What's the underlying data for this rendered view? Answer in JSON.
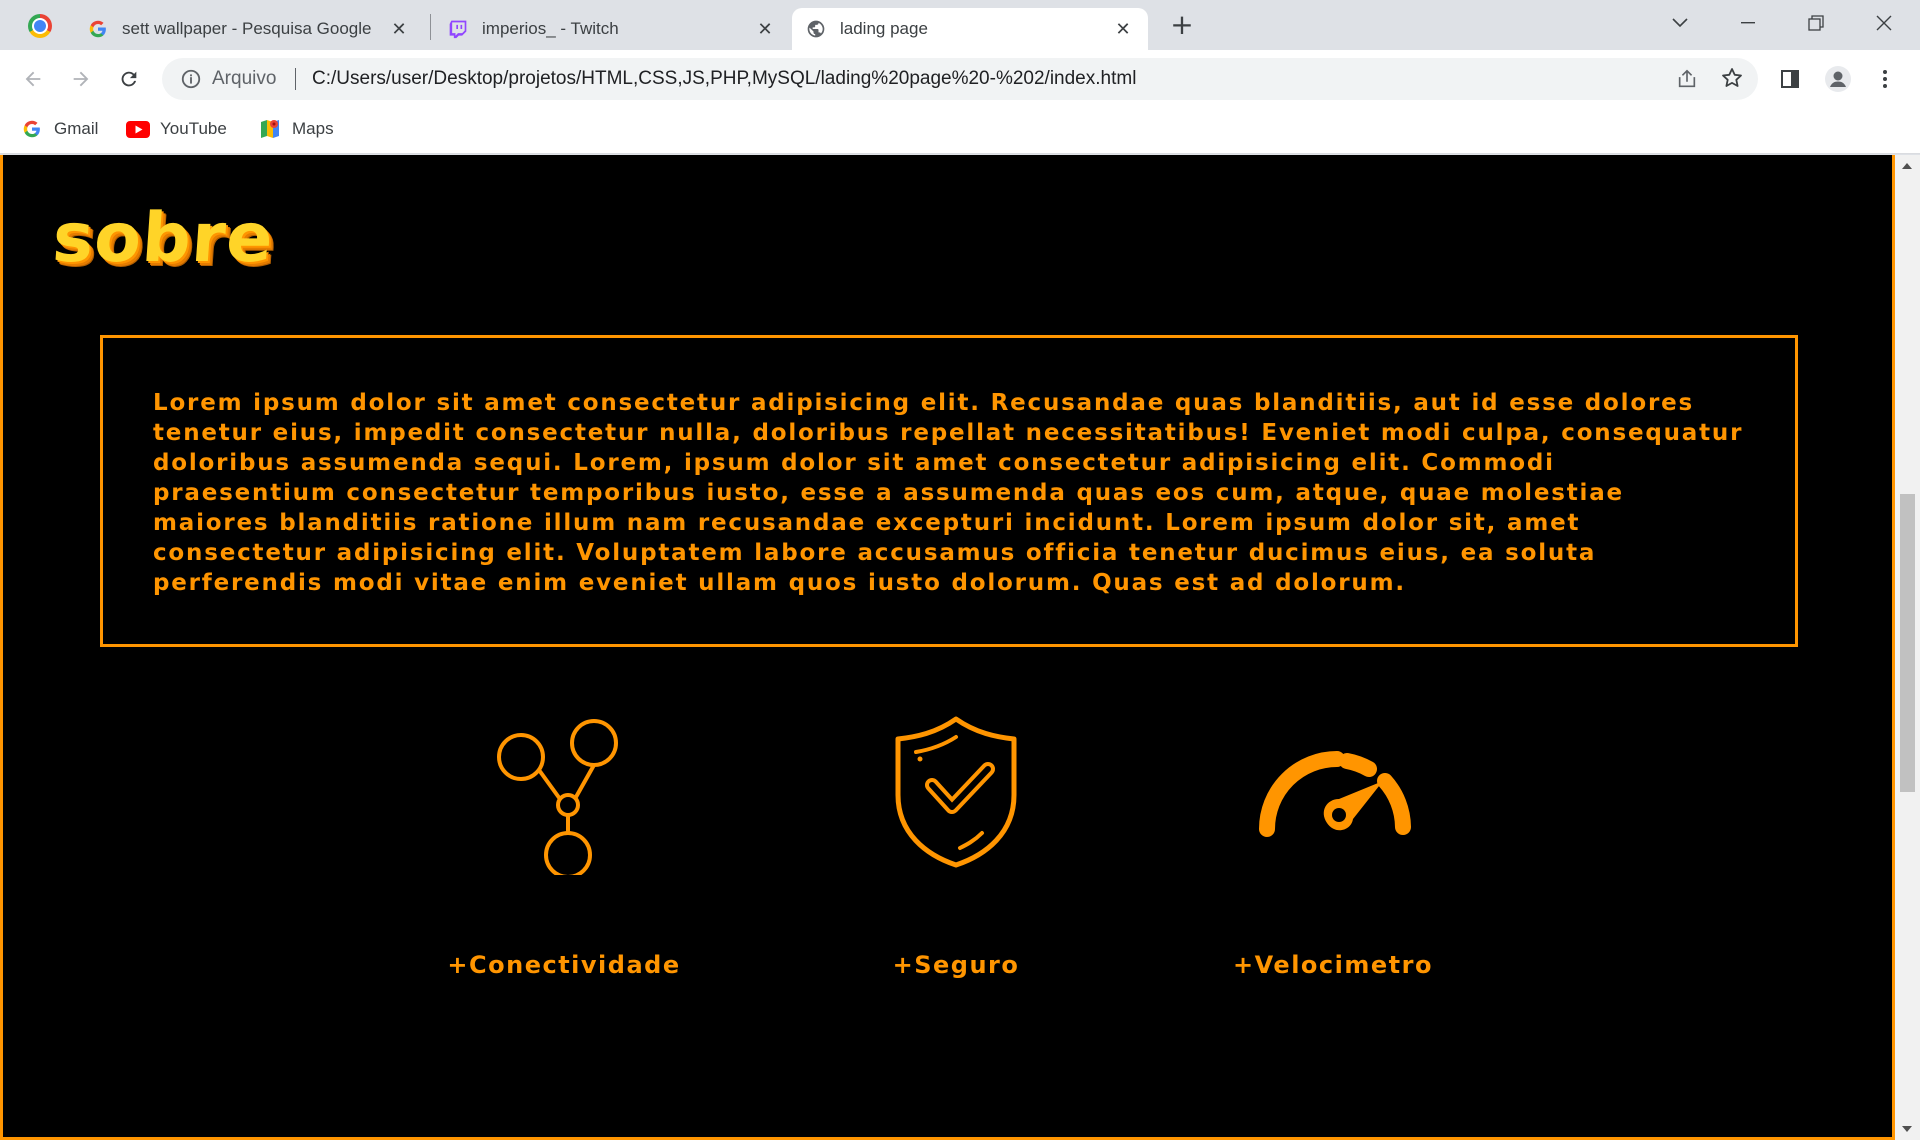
{
  "tabs": [
    {
      "title": "sett wallpaper - Pesquisa Google",
      "favicon": "google-icon"
    },
    {
      "title": "imperios_ - Twitch",
      "favicon": "twitch-icon"
    },
    {
      "title": "lading page",
      "favicon": "globe-icon",
      "active": true
    }
  ],
  "address_bar": {
    "scheme_label": "Arquivo",
    "url": "C:/Users/user/Desktop/projetos/HTML,CSS,JS,PHP,MySQL/lading%20page%20-%202/index.html"
  },
  "bookmarks": [
    {
      "label": "Gmail",
      "icon": "google-icon"
    },
    {
      "label": "YouTube",
      "icon": "youtube-icon"
    },
    {
      "label": "Maps",
      "icon": "maps-icon"
    }
  ],
  "page": {
    "heading": "sobre",
    "body_text": "Lorem ipsum dolor sit amet consectetur adipisicing elit. Recusandae quas blanditiis, aut id esse dolores tenetur eius, impedit consectetur nulla, doloribus repellat necessitatibus! Eveniet modi culpa, consequatur doloribus assumenda sequi. Lorem, ipsum dolor sit amet consectetur adipisicing elit. Commodi praesentium consectetur temporibus iusto, esse a assumenda quas eos cum, atque, quae molestiae maiores blanditiis ratione illum nam recusandae excepturi incidunt. Lorem ipsum dolor sit, amet consectetur adipisicing elit. Voluptatem labore accusamus officia tenetur ducimus eius, ea soluta perferendis modi vitae enim eveniet ullam quos iusto dolorum. Quas est ad dolorum.",
    "features": [
      {
        "label": "+Conectividade",
        "icon": "network-icon"
      },
      {
        "label": "+Seguro",
        "icon": "shield-check-icon"
      },
      {
        "label": "+Velocimetro",
        "icon": "speedometer-icon"
      }
    ]
  },
  "colors": {
    "accent": "#ff9500",
    "page_background": "#000000",
    "heading_fill": "#ffd428"
  }
}
